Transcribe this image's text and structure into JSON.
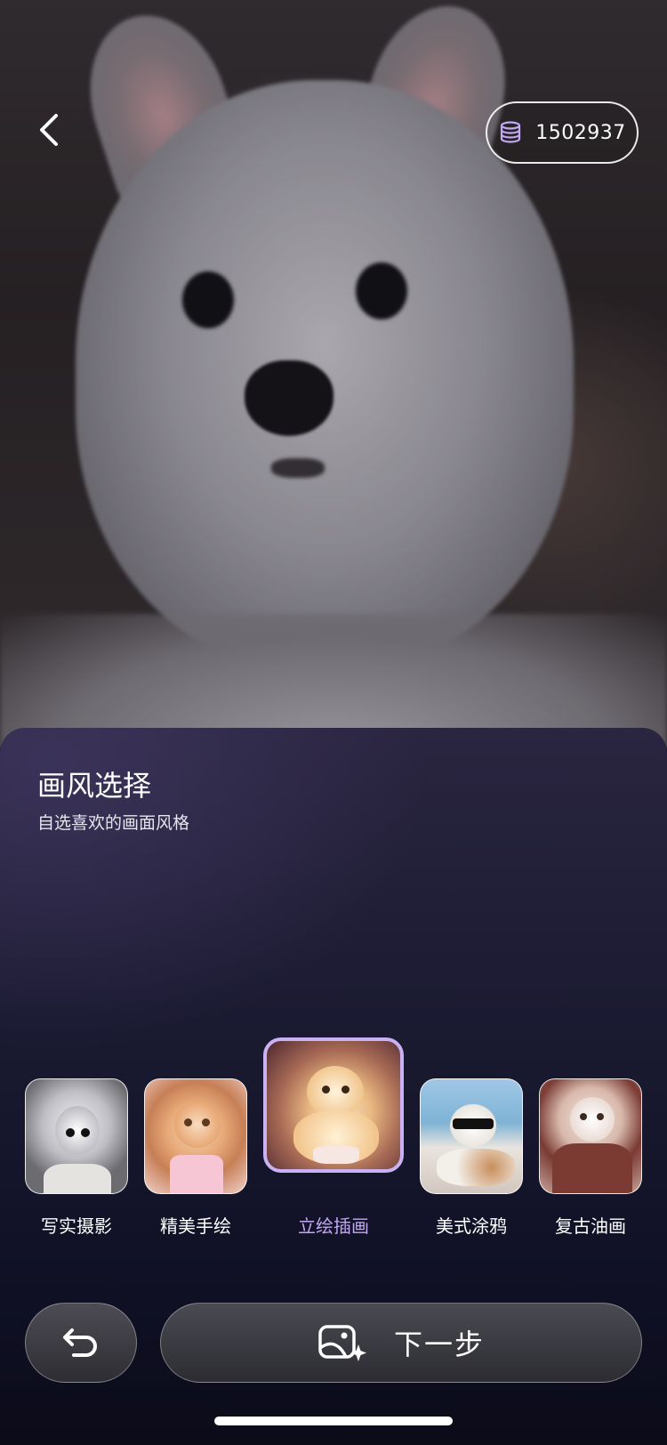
{
  "header": {
    "back_icon": "chevron-left-icon",
    "coins": {
      "icon": "coin-stack-icon",
      "count": "1502937"
    }
  },
  "sheet": {
    "title": "画风选择",
    "subtitle": "自选喜欢的画面风格"
  },
  "styles": [
    {
      "label": "写实摄影",
      "selected": false
    },
    {
      "label": "精美手绘",
      "selected": false
    },
    {
      "label": "立绘插画",
      "selected": true
    },
    {
      "label": "美式涂鸦",
      "selected": false
    },
    {
      "label": "复古油画",
      "selected": false
    }
  ],
  "actions": {
    "undo_icon": "undo-arrow-icon",
    "next_icon": "image-sparkle-icon",
    "next_label": "下一步"
  },
  "colors": {
    "accent": "#c9b2f4",
    "selected_label": "#c3a8f3"
  }
}
